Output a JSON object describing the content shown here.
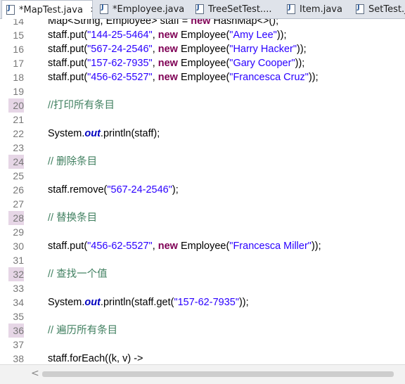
{
  "tabs": [
    {
      "label": "*MapTest.java",
      "active": true,
      "close": "✕"
    },
    {
      "label": "*Employee.java"
    },
    {
      "label": "TreeSetTest...."
    },
    {
      "label": "Item.java"
    },
    {
      "label": "SetTest.java"
    }
  ],
  "code_lines": [
    {
      "n": "14",
      "text": "Map<String, Employee> staff = new HashMap<>();"
    },
    {
      "n": "15",
      "text": "staff.put(\"144-25-5464\", new Employee(\"Amy Lee\"));"
    },
    {
      "n": "16",
      "text": "staff.put(\"567-24-2546\", new Employee(\"Harry Hacker\"));"
    },
    {
      "n": "17",
      "text": "staff.put(\"157-62-7935\", new Employee(\"Gary Cooper\"));"
    },
    {
      "n": "18",
      "text": "staff.put(\"456-62-5527\", new Employee(\"Francesca Cruz\"));"
    },
    {
      "n": "19",
      "text": ""
    },
    {
      "n": "20",
      "text": "//打印所有条目",
      "marked": true
    },
    {
      "n": "21",
      "text": ""
    },
    {
      "n": "22",
      "text": "System.out.println(staff);"
    },
    {
      "n": "23",
      "text": ""
    },
    {
      "n": "24",
      "text": "// 删除条目",
      "marked": true
    },
    {
      "n": "25",
      "text": ""
    },
    {
      "n": "26",
      "text": "staff.remove(\"567-24-2546\");"
    },
    {
      "n": "27",
      "text": ""
    },
    {
      "n": "28",
      "text": "// 替换条目",
      "marked": true
    },
    {
      "n": "29",
      "text": ""
    },
    {
      "n": "30",
      "text": "staff.put(\"456-62-5527\", new Employee(\"Francesca Miller\"));"
    },
    {
      "n": "31",
      "text": ""
    },
    {
      "n": "32",
      "text": "// 查找一个值",
      "marked": true
    },
    {
      "n": "33",
      "text": ""
    },
    {
      "n": "34",
      "text": "System.out.println(staff.get(\"157-62-7935\"));"
    },
    {
      "n": "35",
      "text": ""
    },
    {
      "n": "36",
      "text": "// 遍历所有条目",
      "marked": true
    },
    {
      "n": "37",
      "text": ""
    },
    {
      "n": "38",
      "text": "staff.forEach((k, v) ->"
    }
  ],
  "scroll_left_arrow": "<",
  "colors": {
    "keyword": "#7f0055",
    "string": "#2a00ff",
    "comment": "#3f7f5f",
    "field": "#0000c0"
  }
}
